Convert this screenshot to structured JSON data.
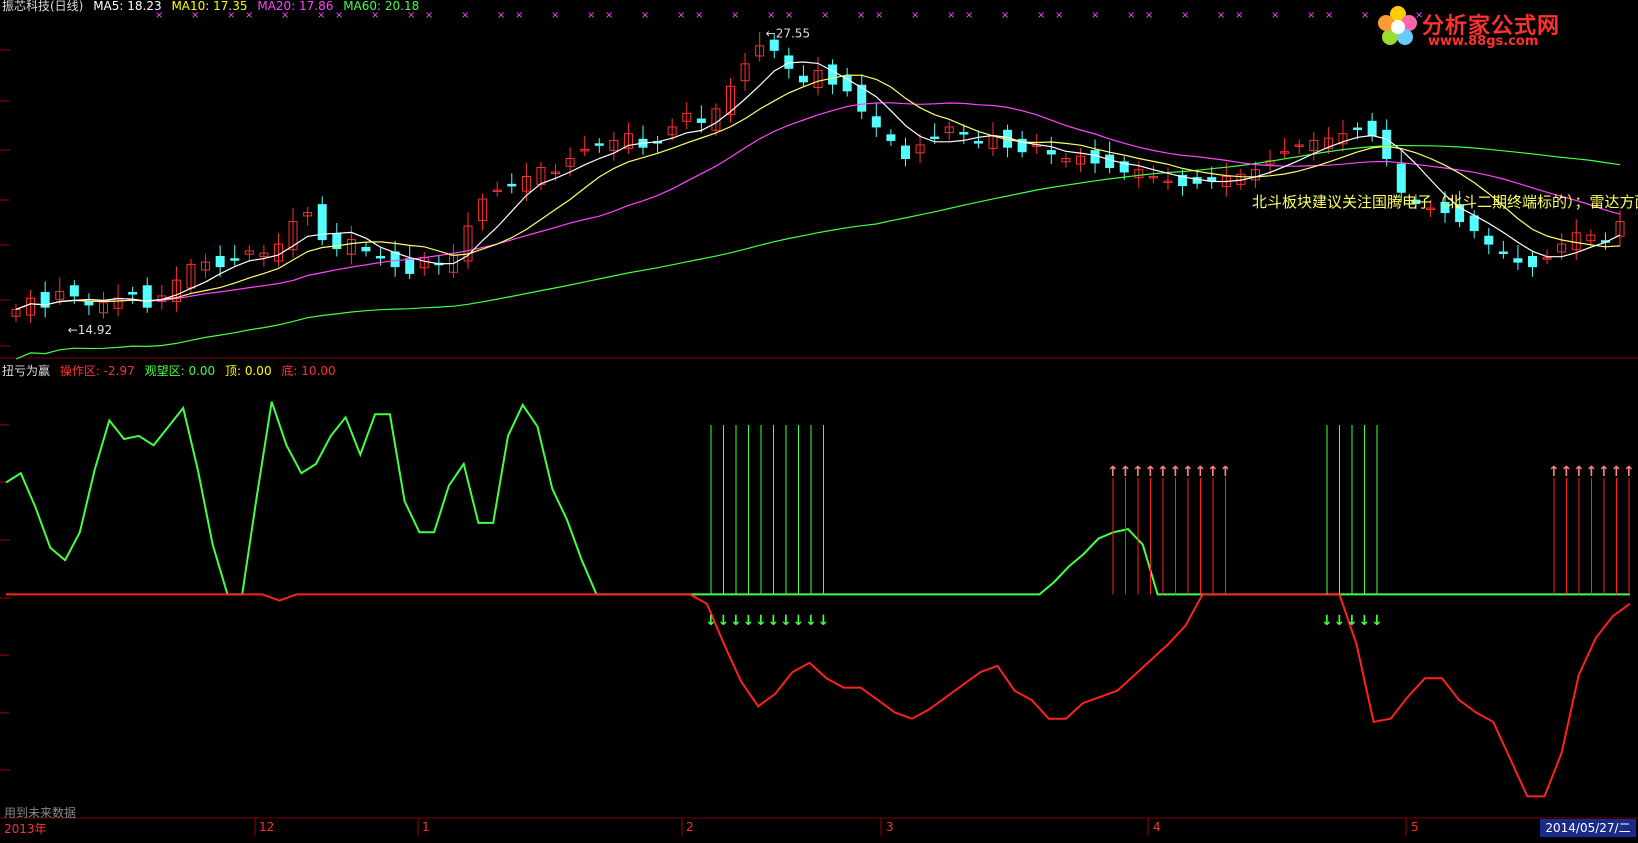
{
  "main_legend": {
    "title": "振芯科技(日线)",
    "items": [
      {
        "label": "MA5: 18.23",
        "color": "#ffffff"
      },
      {
        "label": "MA10: 17.35",
        "color": "#ffff00"
      },
      {
        "label": "MA20: 17.86",
        "color": "#ff44ff"
      },
      {
        "label": "MA60: 20.18",
        "color": "#44ff44"
      }
    ]
  },
  "indicator_legend": {
    "title": "扭亏为赢",
    "items": [
      {
        "label": "操作区: -2.97",
        "color": "#ff3030"
      },
      {
        "label": "观望区: 0.00",
        "color": "#44ff44"
      },
      {
        "label": "顶: 0.00",
        "color": "#ffff00"
      },
      {
        "label": "底: 10.00",
        "color": "#ff3030"
      }
    ]
  },
  "price_markers": {
    "high": "27.55",
    "low": "14.92"
  },
  "annotation": "北斗板块建议关注国腾电子（北斗二期终端标的）；雷达方面，",
  "logo": {
    "title": "分析家公式网",
    "url": "www.88gs.com"
  },
  "bottom": {
    "future_label": "用到未来数据",
    "axis_labels": [
      "2013年",
      "12",
      "1",
      "2",
      "3",
      "4",
      "5"
    ],
    "date_badge": "2014/05/27/二"
  },
  "colors": {
    "up_candle": "#ff3030",
    "down_candle": "#54ffff",
    "ma5": "#ffffff",
    "ma10": "#ffff66",
    "ma20": "#ff44ff",
    "ma60": "#44ff44",
    "indicator_green": "#44ff44",
    "indicator_red": "#ff2020",
    "grid": "#7a0000"
  },
  "chart_data": [
    {
      "type": "candlestick",
      "title": "振芯科技(日线)",
      "ylim": [
        13.5,
        28.5
      ],
      "x_labels": [
        "2013年",
        "12",
        "1",
        "2",
        "3",
        "4",
        "5"
      ],
      "close": [
        15.3,
        15.8,
        15.4,
        16.1,
        15.9,
        15.5,
        15.6,
        15.8,
        16.0,
        15.4,
        15.9,
        16.6,
        17.3,
        17.4,
        17.2,
        17.5,
        17.9,
        17.8,
        18.2,
        19.2,
        19.6,
        18.4,
        18.0,
        18.4,
        17.9,
        17.6,
        17.2,
        16.9,
        17.6,
        17.3,
        17.7,
        19.0,
        20.2,
        20.6,
        20.8,
        21.2,
        21.6,
        21.4,
        22.0,
        22.4,
        22.6,
        22.8,
        23.1,
        22.5,
        22.7,
        23.4,
        24.0,
        23.6,
        24.2,
        25.2,
        26.2,
        27.0,
        26.8,
        26.0,
        25.4,
        25.9,
        25.3,
        25.0,
        24.1,
        23.4,
        22.8,
        22.0,
        22.6,
        22.9,
        23.4,
        23.1,
        22.7,
        23.0,
        22.5,
        22.3,
        22.6,
        22.2,
        22.0,
        22.1,
        21.8,
        21.6,
        21.4,
        21.5,
        21.2,
        21.0,
        20.8,
        20.9,
        21.0,
        21.2,
        21.3,
        21.5,
        21.9,
        22.3,
        22.6,
        22.8,
        22.9,
        23.1,
        23.3,
        23.0,
        22.0,
        20.5,
        20.0,
        19.8,
        19.6,
        19.2,
        18.8,
        18.2,
        17.8,
        17.4,
        17.2,
        17.6,
        18.2,
        18.7,
        18.6,
        18.3,
        19.2
      ]
    },
    {
      "type": "line",
      "title": "扭亏为赢",
      "series": [
        {
          "name": "观望区",
          "values": [
            8.2,
            8.5,
            7.4,
            6.1,
            5.7,
            6.6,
            8.6,
            10.2,
            9.6,
            9.7,
            9.4,
            10.0,
            10.6,
            8.6,
            6.2,
            4.6,
            4.6,
            7.8,
            10.8,
            9.4,
            8.5,
            8.8,
            9.7,
            10.3,
            9.1,
            10.4,
            10.4,
            7.6,
            6.6,
            6.6,
            8.1,
            8.8,
            6.9,
            6.9,
            9.7,
            10.7,
            10.0,
            8.0,
            7.0,
            5.7,
            4.6,
            4.6,
            4.6,
            4.6,
            4.6,
            4.6,
            4.6,
            4.6,
            4.6,
            4.6,
            4.6,
            4.6,
            4.6,
            4.6,
            4.6,
            4.6,
            4.6,
            4.6,
            4.6,
            4.6,
            4.6,
            4.6,
            4.6,
            4.6,
            4.6,
            4.6,
            4.6,
            4.6,
            4.6,
            4.6,
            4.6,
            5.0,
            5.5,
            5.9,
            6.4,
            6.6,
            6.7,
            6.2,
            4.6,
            4.6,
            4.6,
            4.6,
            4.6,
            4.6,
            4.6,
            4.6,
            4.6,
            4.6,
            4.6,
            4.6,
            4.6,
            4.6,
            4.6,
            4.6,
            4.6,
            4.6,
            4.6,
            4.6,
            4.6,
            4.6,
            4.6,
            4.6,
            4.6,
            4.6,
            4.6,
            4.6,
            4.6,
            4.6,
            4.6,
            4.6,
            4.6
          ]
        },
        {
          "name": "操作区",
          "values": [
            4.6,
            4.6,
            4.6,
            4.6,
            4.6,
            4.6,
            4.6,
            4.6,
            4.6,
            4.6,
            4.6,
            4.6,
            4.6,
            4.6,
            4.6,
            4.6,
            4.4,
            4.6,
            4.6,
            4.6,
            4.6,
            4.6,
            4.6,
            4.6,
            4.6,
            4.6,
            4.6,
            4.6,
            4.6,
            4.6,
            4.6,
            4.6,
            4.6,
            4.6,
            4.6,
            4.6,
            4.6,
            4.6,
            4.6,
            4.6,
            4.6,
            4.3,
            3.0,
            1.8,
            1.0,
            1.4,
            2.1,
            2.4,
            1.9,
            1.6,
            1.6,
            1.2,
            0.8,
            0.6,
            0.9,
            1.3,
            1.7,
            2.1,
            2.3,
            1.5,
            1.2,
            0.6,
            0.6,
            1.1,
            1.3,
            1.5,
            2.0,
            2.5,
            3.0,
            3.6,
            4.6,
            4.6,
            4.6,
            4.6,
            4.6,
            4.6,
            4.6,
            4.6,
            4.6,
            3.0,
            0.5,
            0.6,
            1.3,
            1.9,
            1.9,
            1.2,
            0.8,
            0.5,
            -0.7,
            -1.9,
            -1.9,
            -0.5,
            2.0,
            3.2,
            3.9,
            4.3
          ]
        }
      ]
    }
  ]
}
